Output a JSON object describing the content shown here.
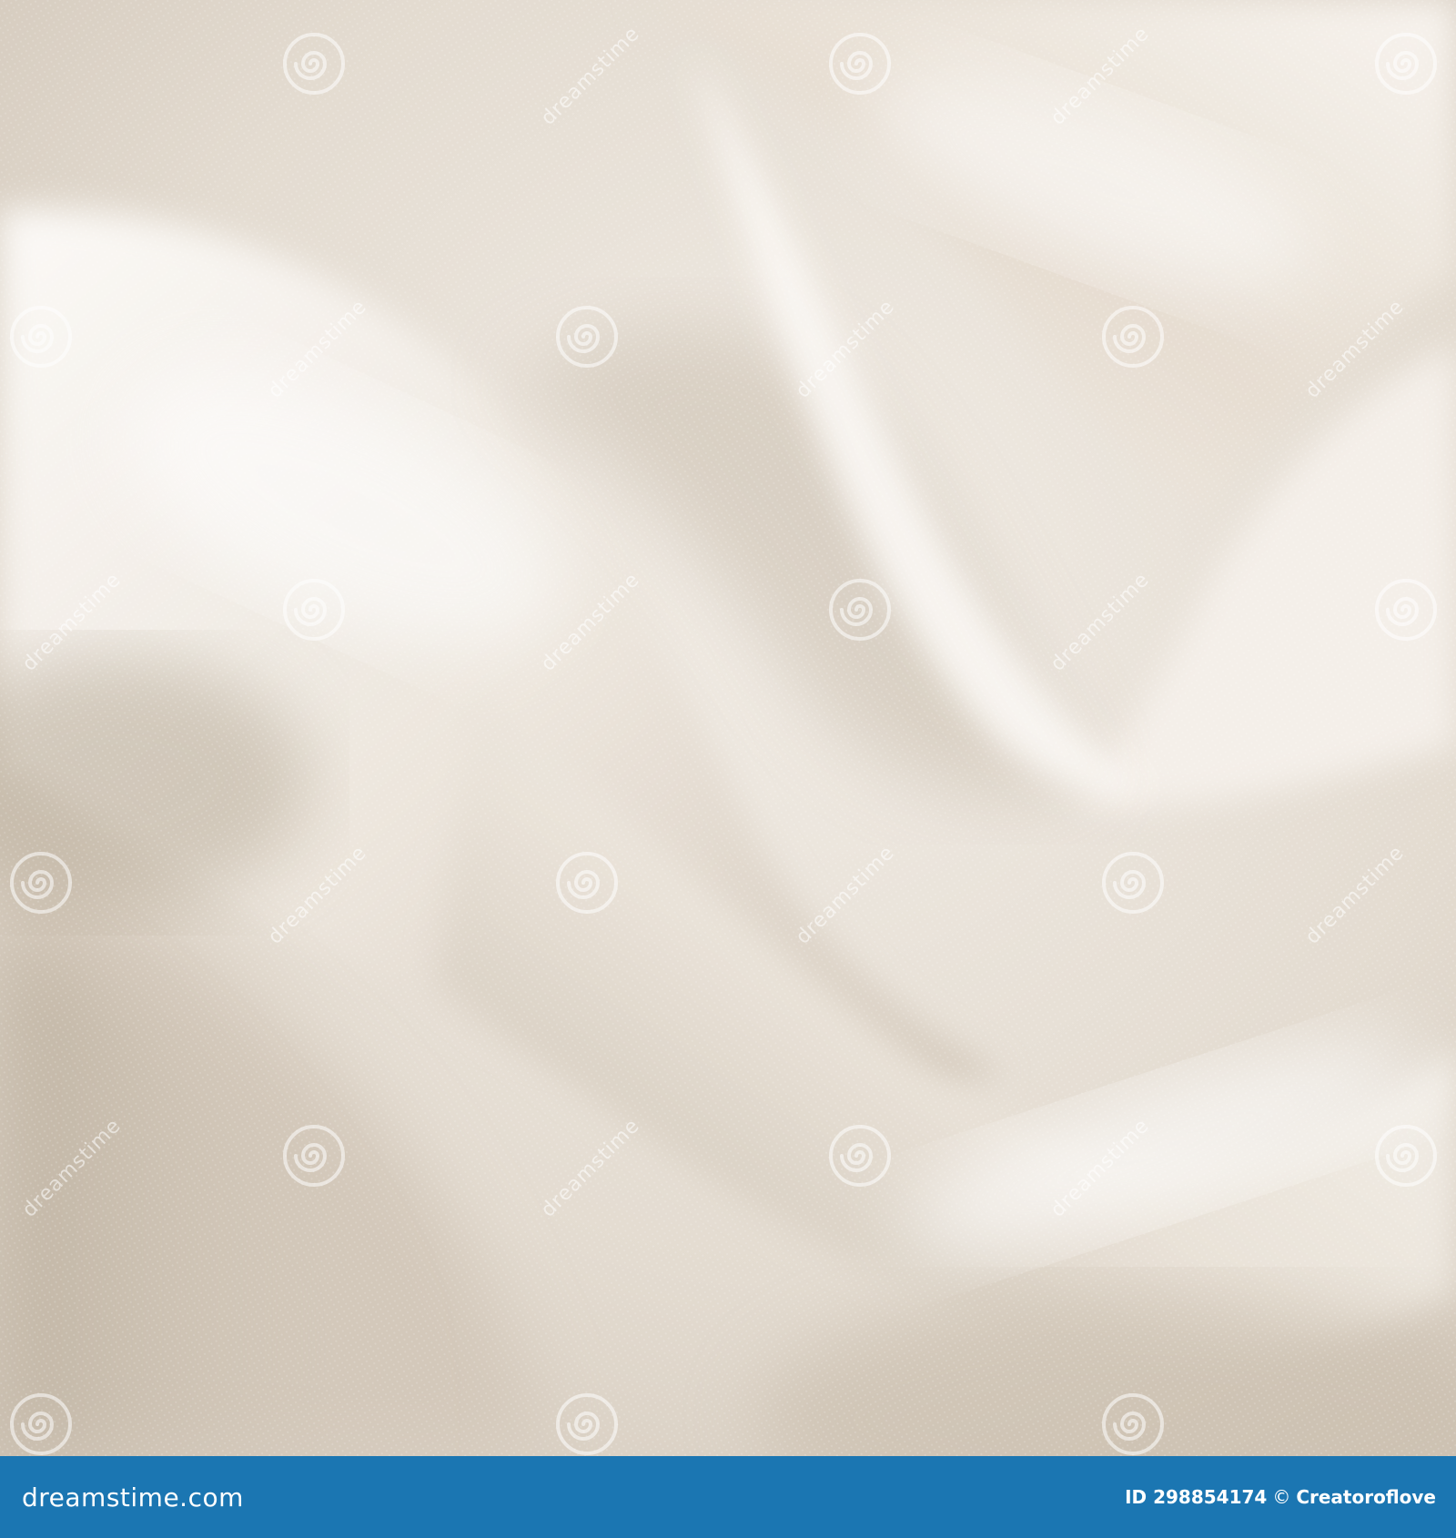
{
  "photo": {
    "subject": "draped ivory fabric close-up",
    "palette": {
      "highlight": "#fbf8f4",
      "midtone": "#e9e2d9",
      "shadow": "#c9bfb3",
      "deep_shadow": "#b3a795"
    }
  },
  "watermark": {
    "text": "dreamstime",
    "icon": "spiral-logo-icon"
  },
  "footer": {
    "brand": "dreamstime.com",
    "id_label": "ID 298854174",
    "copyright_symbol": "©",
    "author": "Creatoroflove",
    "background": "#1b76b2"
  }
}
